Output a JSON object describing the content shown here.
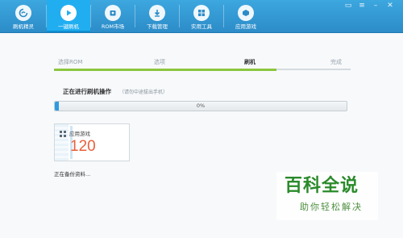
{
  "toolbar": {
    "items": [
      {
        "label": "刷机精灵",
        "icon": "swirl-logo-icon"
      },
      {
        "label": "一键刷机",
        "icon": "play-icon"
      },
      {
        "label": "ROM市场",
        "icon": "store-icon"
      },
      {
        "label": "下载管理",
        "icon": "download-icon"
      },
      {
        "label": "实用工具",
        "icon": "tools-grid-icon"
      },
      {
        "label": "应用游戏",
        "icon": "app-icon"
      }
    ],
    "active_index": 1,
    "window_controls": [
      "chat-icon",
      "menu-icon",
      "minimize-icon",
      "close-icon"
    ]
  },
  "steps": {
    "labels": [
      "选择ROM",
      "选项",
      "刷机",
      "完成"
    ],
    "current_index": 2
  },
  "operation": {
    "title": "正在进行刷机操作",
    "hint": "（请勿中途拔出手机）"
  },
  "progress": {
    "value": 0.015,
    "label": "0%"
  },
  "card": {
    "title": "应用游戏",
    "count": "120"
  },
  "status_text": "正在备份资料...",
  "watermark": {
    "title": "百科全说",
    "subtitle": "助你轻松解决"
  },
  "colors": {
    "toolbar": "#2c8cc8",
    "active_tab": "#21aef0",
    "step_fill": "#8cc63e",
    "progress_fill": "#2d9be0",
    "count": "#e8603c",
    "watermark": "#2a8a2a"
  }
}
